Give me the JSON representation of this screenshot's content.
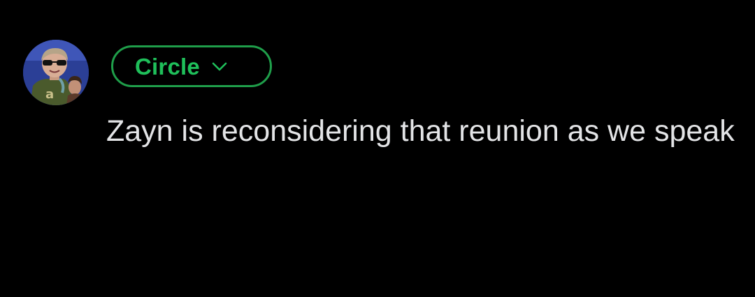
{
  "post": {
    "audience": {
      "label": "Circle",
      "icon": "chevron-down-icon",
      "color": "#1fbf5a"
    },
    "avatar": {
      "icon": "user-avatar-photo"
    },
    "text": "Zayn is reconsidering that reunion as we speak"
  },
  "theme": {
    "background": "#000000",
    "text_color": "#e3e4e6",
    "accent": "#1f9e4a"
  }
}
